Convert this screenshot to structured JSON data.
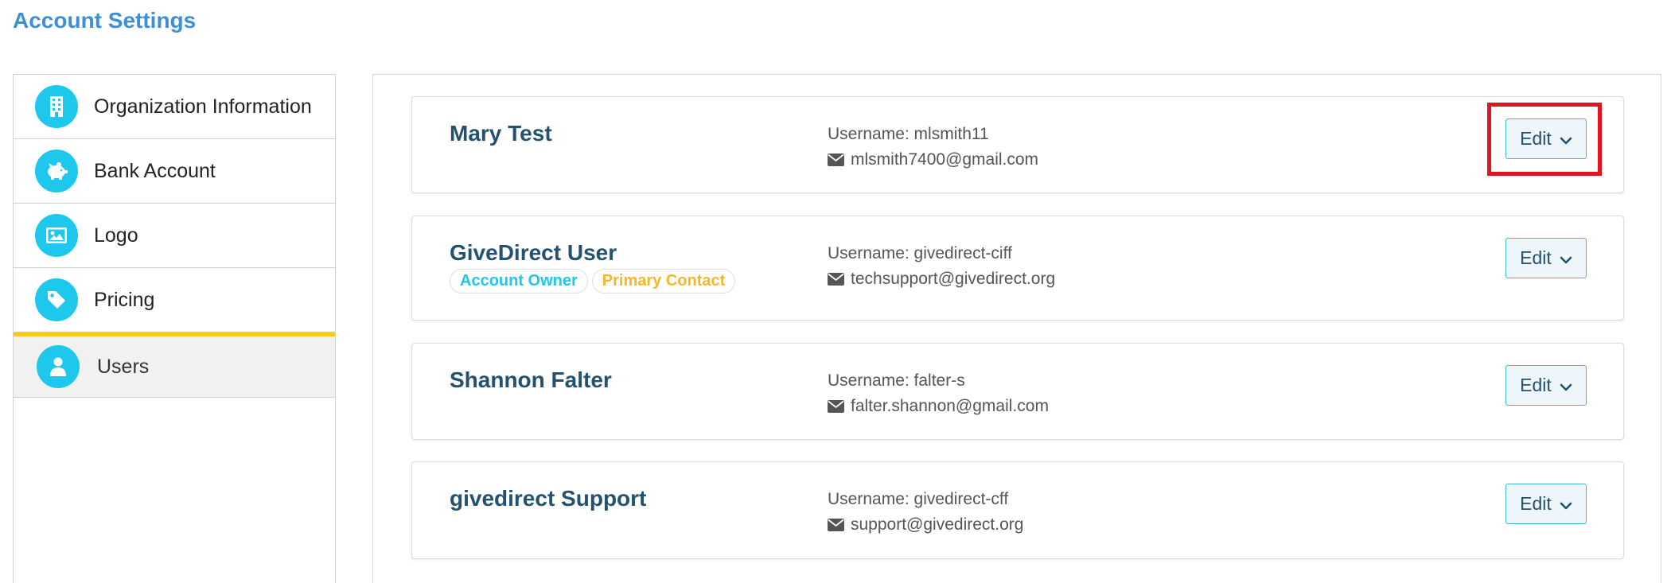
{
  "page": {
    "title": "Account Settings"
  },
  "sidebar": {
    "items": [
      {
        "label": "Organization Information",
        "icon": "building-icon"
      },
      {
        "label": "Bank Account",
        "icon": "piggy-bank-icon"
      },
      {
        "label": "Logo",
        "icon": "image-icon"
      },
      {
        "label": "Pricing",
        "icon": "tag-icon"
      },
      {
        "label": "Users",
        "icon": "user-icon",
        "active": true
      }
    ]
  },
  "users": [
    {
      "name": "Mary Test",
      "username": "Username: mlsmith11",
      "email": "mlsmith7400@gmail.com",
      "edit_label": "Edit",
      "highlighted": true
    },
    {
      "name": "GiveDirect User",
      "badges": [
        "Account Owner",
        "Primary Contact"
      ],
      "username": "Username: givedirect-ciff",
      "email": "techsupport@givedirect.org",
      "edit_label": "Edit"
    },
    {
      "name": "Shannon Falter",
      "username": "Username: falter-s",
      "email": "falter.shannon@gmail.com",
      "edit_label": "Edit"
    },
    {
      "name": "givedirect Support",
      "username": "Username: givedirect-cff",
      "email": "support@givedirect.org",
      "edit_label": "Edit"
    }
  ],
  "colors": {
    "accent_blue": "#3d8fd6",
    "icon_cyan": "#1ec8ec",
    "active_underline": "#f8c91f",
    "name_navy": "#23516e",
    "badge_owner": "#1ec8ec",
    "badge_contact": "#f3b82a",
    "highlight_red": "#e0151f"
  }
}
